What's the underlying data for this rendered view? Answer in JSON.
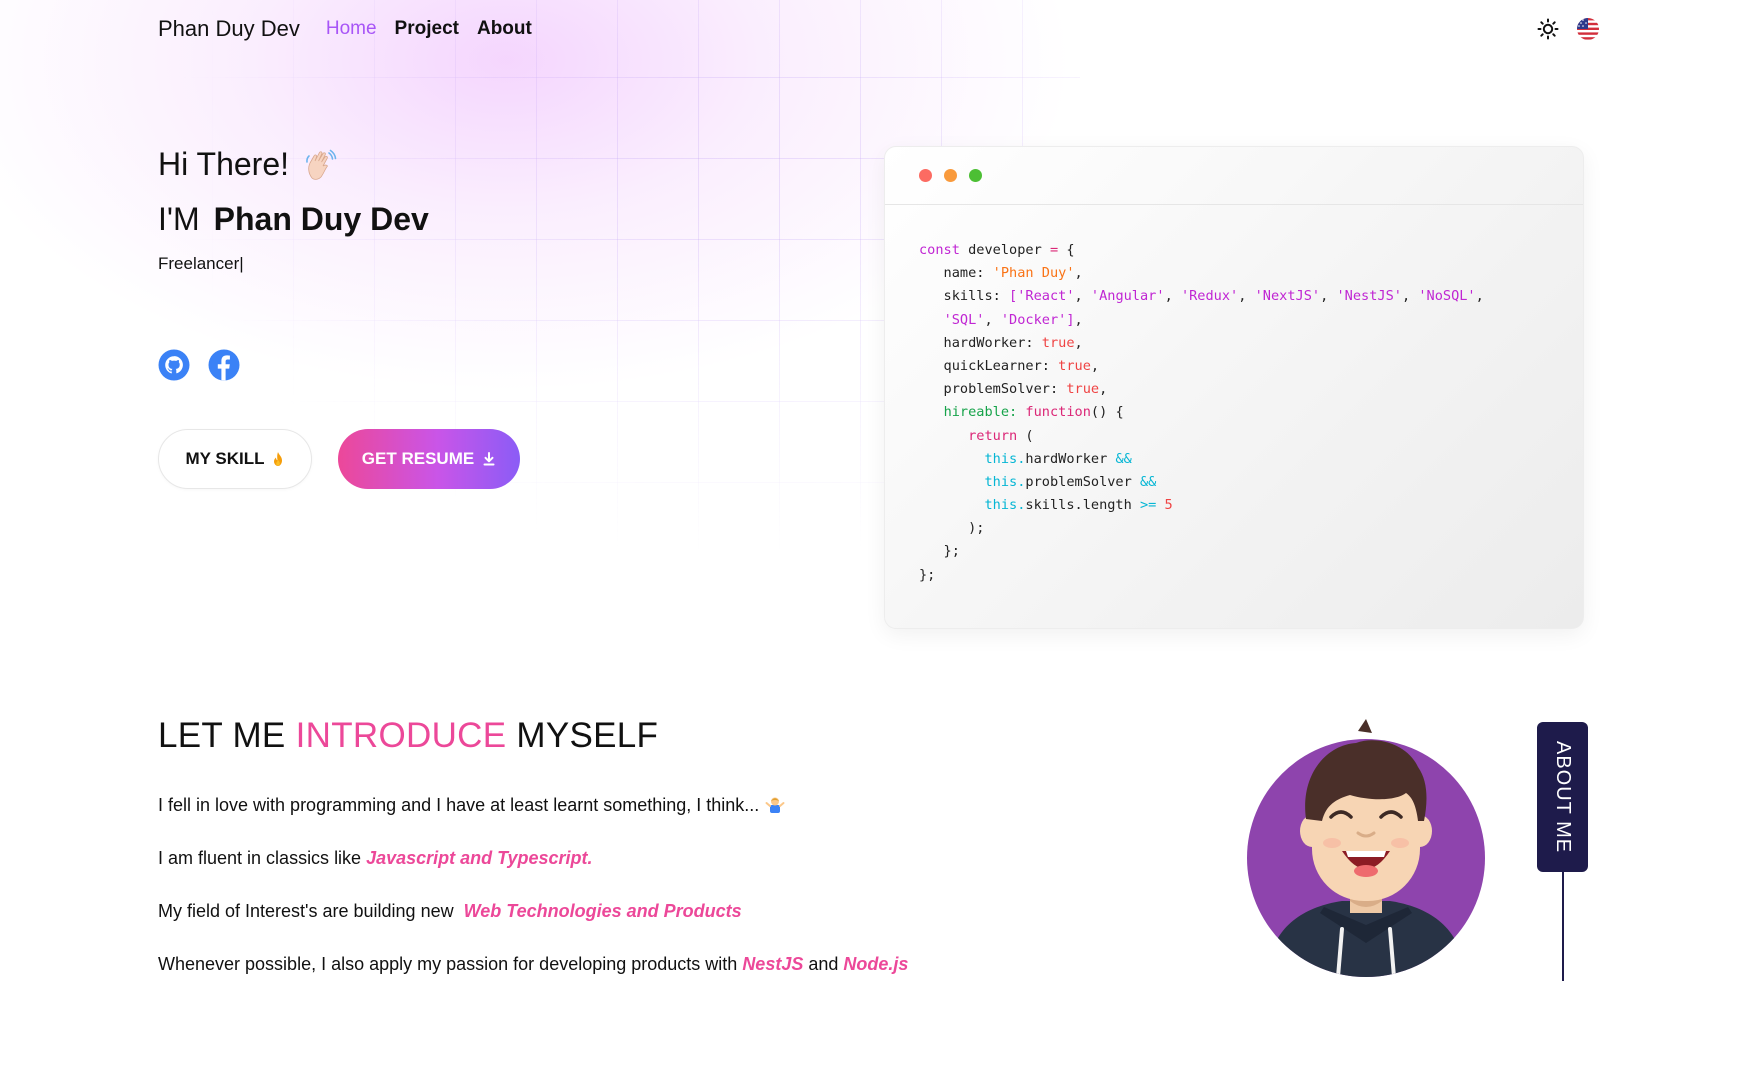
{
  "nav": {
    "brand": "Phan Duy Dev",
    "links": [
      {
        "label": "Home",
        "active": true
      },
      {
        "label": "Project",
        "active": false
      },
      {
        "label": "About",
        "active": false
      }
    ],
    "theme_icon": "sun-icon",
    "language_icon": "us-flag-icon"
  },
  "hero": {
    "greeting": "Hi There!",
    "greeting_icon": "waving-hand-icon",
    "im_prefix": "I'M",
    "name": "Phan Duy Dev",
    "role": "Freelancer|",
    "socials": [
      {
        "name": "github-icon"
      },
      {
        "name": "facebook-icon"
      }
    ],
    "skill_button": "MY SKILL",
    "skill_icon": "fire-icon",
    "resume_button": "GET RESUME",
    "resume_icon": "download-icon"
  },
  "code": {
    "dots": [
      "#fc6b62",
      "#f99a3c",
      "#4cbf34"
    ],
    "lines": [
      [
        [
          "kw",
          "const"
        ],
        [
          "t",
          " developer "
        ],
        [
          "op",
          "="
        ],
        [
          "t",
          " {"
        ]
      ],
      [
        [
          "t",
          "   name: "
        ],
        [
          "str",
          "'Phan Duy'"
        ],
        [
          "t",
          ","
        ]
      ],
      [
        [
          "t",
          "   skills: "
        ],
        [
          "arr",
          "['React'"
        ],
        [
          "t",
          ", "
        ],
        [
          "arr",
          "'Angular'"
        ],
        [
          "t",
          ", "
        ],
        [
          "arr",
          "'Redux'"
        ],
        [
          "t",
          ", "
        ],
        [
          "arr",
          "'NextJS'"
        ],
        [
          "t",
          ", "
        ],
        [
          "arr",
          "'NestJS'"
        ],
        [
          "t",
          ", "
        ],
        [
          "arr",
          "'NoSQL'"
        ],
        [
          "t",
          ","
        ]
      ],
      [
        [
          "t",
          "   "
        ],
        [
          "arr",
          "'SQL'"
        ],
        [
          "t",
          ", "
        ],
        [
          "arr",
          "'Docker'"
        ],
        [
          "arr",
          "]"
        ],
        [
          "t",
          ","
        ]
      ],
      [
        [
          "t",
          "   hardWorker: "
        ],
        [
          "bool",
          "true"
        ],
        [
          "t",
          ","
        ]
      ],
      [
        [
          "t",
          "   quickLearner: "
        ],
        [
          "bool",
          "true"
        ],
        [
          "t",
          ","
        ]
      ],
      [
        [
          "t",
          "   problemSolver: "
        ],
        [
          "bool",
          "true"
        ],
        [
          "t",
          ","
        ]
      ],
      [
        [
          "t",
          "   "
        ],
        [
          "fn",
          "hireable:"
        ],
        [
          "t",
          " "
        ],
        [
          "op",
          "function"
        ],
        [
          "t",
          "() {"
        ]
      ],
      [
        [
          "t",
          "      "
        ],
        [
          "op",
          "return"
        ],
        [
          "t",
          " ("
        ]
      ],
      [
        [
          "t",
          "        "
        ],
        [
          "this",
          "this."
        ],
        [
          "t",
          "hardWorker "
        ],
        [
          "this",
          "&&"
        ]
      ],
      [
        [
          "t",
          "        "
        ],
        [
          "this",
          "this."
        ],
        [
          "t",
          "problemSolver "
        ],
        [
          "this",
          "&&"
        ]
      ],
      [
        [
          "t",
          "        "
        ],
        [
          "this",
          "this."
        ],
        [
          "t",
          "skills.length "
        ],
        [
          "this",
          ">="
        ],
        [
          "t",
          " "
        ],
        [
          "num",
          "5"
        ]
      ],
      [
        [
          "t",
          "      );"
        ]
      ],
      [
        [
          "t",
          "   };"
        ]
      ],
      [
        [
          "t",
          "};"
        ]
      ]
    ]
  },
  "intro": {
    "title_pre": "LET ME ",
    "title_hl": "INTRODUCE",
    "title_post": " MYSELF",
    "p1": "I fell in love with programming and I have at least learnt something, I think...",
    "p1_icon": "shrugging-person-icon",
    "p2_pre": "I am fluent in classics like ",
    "p2_hl": "Javascript and Typescript.",
    "p3_pre": "My field of Interest's are building new  ",
    "p3_hl": "Web Technologies and Products",
    "p4_pre": "Whenever possible, I also apply my passion for developing products with ",
    "p4_hl1": "NestJS",
    "p4_mid": " and ",
    "p4_hl2": "Node.js"
  },
  "about_tag": "ABOUT ME",
  "colors": {
    "accent_pink": "#ec4899",
    "accent_purple": "#a855f7",
    "navy": "#1e1b4b",
    "avatar_bg": "#8e44ad"
  }
}
